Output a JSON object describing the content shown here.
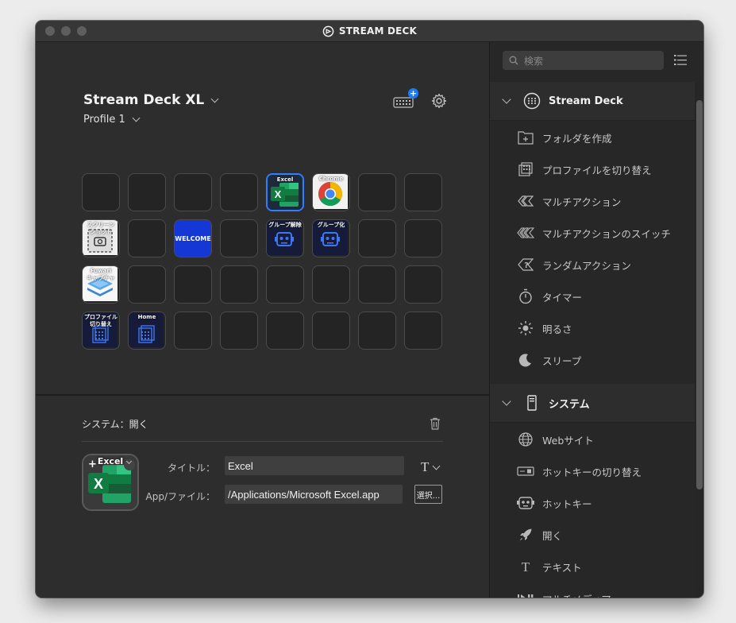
{
  "window": {
    "title": "STREAM DECK"
  },
  "device": {
    "name": "Stream Deck XL",
    "profile": "Profile 1",
    "add_badge": "+"
  },
  "keys": [
    {
      "type": "empty"
    },
    {
      "type": "empty"
    },
    {
      "type": "empty"
    },
    {
      "type": "empty"
    },
    {
      "type": "excel",
      "label": "Excel",
      "selected": true
    },
    {
      "type": "chrome",
      "label": "Chrome"
    },
    {
      "type": "empty"
    },
    {
      "type": "empty"
    },
    {
      "type": "screenshot",
      "label": "スクリーン",
      "label2": "ショット"
    },
    {
      "type": "empty"
    },
    {
      "type": "welcome",
      "label": "WELCOME"
    },
    {
      "type": "empty"
    },
    {
      "type": "robot",
      "label": "グループ解除"
    },
    {
      "type": "robot",
      "label": "グループ化"
    },
    {
      "type": "empty"
    },
    {
      "type": "empty"
    },
    {
      "type": "stack",
      "label": "Fuwari",
      "label2": "キャプチャ"
    },
    {
      "type": "empty"
    },
    {
      "type": "empty"
    },
    {
      "type": "empty"
    },
    {
      "type": "empty"
    },
    {
      "type": "empty"
    },
    {
      "type": "empty"
    },
    {
      "type": "empty"
    },
    {
      "type": "profile",
      "label": "プロファイル",
      "label2": "切り替え"
    },
    {
      "type": "profile",
      "label": "Home"
    },
    {
      "type": "empty"
    },
    {
      "type": "empty"
    },
    {
      "type": "empty"
    },
    {
      "type": "empty"
    },
    {
      "type": "empty"
    },
    {
      "type": "empty"
    }
  ],
  "action": {
    "title": "システム：開く",
    "key_label": "Excel",
    "plus": "+",
    "title_label": "タイトル：",
    "title_value": "Excel",
    "app_label": "App/ファイル：",
    "app_value": "/Applications/Microsoft Excel.app",
    "select_button": "選択...",
    "text_icon": "T"
  },
  "sidebar": {
    "search_placeholder": "検索",
    "categories": [
      {
        "name": "Stream Deck",
        "icon": "stream-deck-icon",
        "items": [
          {
            "label": "フォルダを作成",
            "icon": "folder-plus-icon"
          },
          {
            "label": "プロファイルを切り替え",
            "icon": "profile-switch-icon"
          },
          {
            "label": "マルチアクション",
            "icon": "multi-action-icon"
          },
          {
            "label": "マルチアクションのスイッチ",
            "icon": "multi-action-switch-icon"
          },
          {
            "label": "ランダムアクション",
            "icon": "random-action-icon"
          },
          {
            "label": "タイマー",
            "icon": "timer-icon"
          },
          {
            "label": "明るさ",
            "icon": "brightness-icon"
          },
          {
            "label": "スリープ",
            "icon": "sleep-icon"
          }
        ]
      },
      {
        "name": "システム",
        "icon": "system-icon",
        "items": [
          {
            "label": "Webサイト",
            "icon": "globe-icon"
          },
          {
            "label": "ホットキーの切り替え",
            "icon": "hotkey-switch-icon"
          },
          {
            "label": "ホットキー",
            "icon": "hotkey-icon"
          },
          {
            "label": "開く",
            "icon": "rocket-icon"
          },
          {
            "label": "テキスト",
            "icon": "text-icon"
          },
          {
            "label": "マルチメディア",
            "icon": "multimedia-icon"
          }
        ]
      }
    ]
  },
  "colors": {
    "accent": "#2f7fff",
    "badge": "#1a7cf5",
    "welcome": "#1437d6",
    "excel_green": "#1f7a44"
  }
}
